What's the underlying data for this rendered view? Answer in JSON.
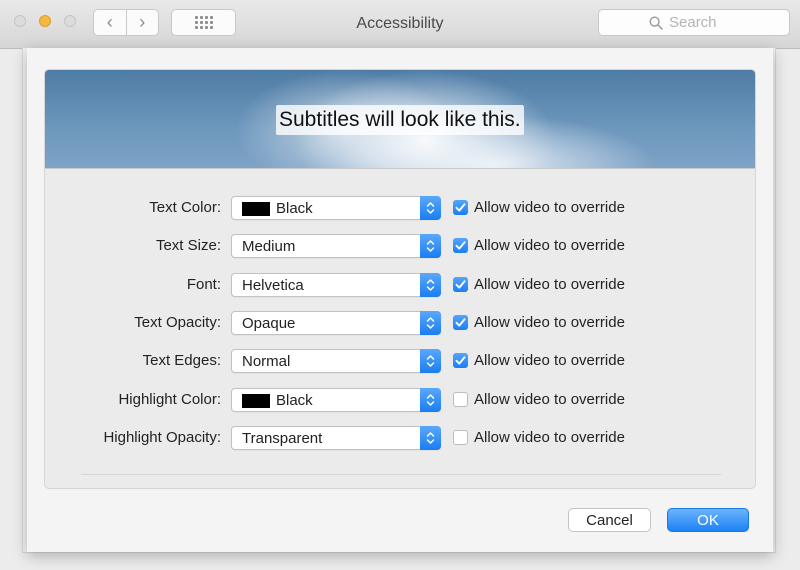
{
  "window": {
    "title": "Accessibility"
  },
  "toolbar": {
    "search_placeholder": "Search",
    "back_glyph": "‹",
    "forward_glyph": "›"
  },
  "preview": {
    "sample_text": "Subtitles will look like this."
  },
  "rows": [
    {
      "label": "Text Color:",
      "value": "Black",
      "swatch": "#000000",
      "override_label": "Allow video to override",
      "override_checked": true
    },
    {
      "label": "Text Size:",
      "value": "Medium",
      "swatch": null,
      "override_label": "Allow video to override",
      "override_checked": true
    },
    {
      "label": "Font:",
      "value": "Helvetica",
      "swatch": null,
      "override_label": "Allow video to override",
      "override_checked": true
    },
    {
      "label": "Text Opacity:",
      "value": "Opaque",
      "swatch": null,
      "override_label": "Allow video to override",
      "override_checked": true
    },
    {
      "label": "Text Edges:",
      "value": "Normal",
      "swatch": null,
      "override_label": "Allow video to override",
      "override_checked": true
    },
    {
      "label": "Highlight Color:",
      "value": "Black",
      "swatch": "#000000",
      "override_label": "Allow video to override",
      "override_checked": false
    },
    {
      "label": "Highlight Opacity:",
      "value": "Transparent",
      "swatch": null,
      "override_label": "Allow video to override",
      "override_checked": false
    }
  ],
  "buttons": {
    "cancel_label": "Cancel",
    "ok_label": "OK"
  },
  "colors": {
    "accent": "#1a7df1",
    "traffic_minimize": "#f5b841"
  }
}
